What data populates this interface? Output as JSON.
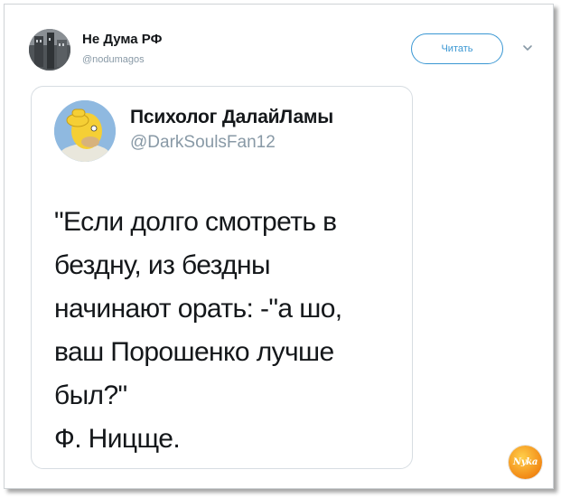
{
  "outer_tweet": {
    "author_name": "Не Дума РФ",
    "author_handle": "@nodumagos",
    "follow_label": "Читать",
    "avatar_icon": "building-avatar-icon",
    "menu_icon": "chevron-down-icon"
  },
  "quoted_tweet": {
    "author_name": "Психолог ДалайЛамы",
    "author_handle": "@DarkSoulsFan12",
    "avatar_icon": "cartoon-character-avatar-icon",
    "text": "\"Если долго смотреть в\nбездну, из бездны\nначинают орать: -\"а шо,\nваш Порошенко лучше\nбыл?\"\nФ. Ницще."
  },
  "watermark": {
    "label": "Nyka",
    "icon": "watermark-logo-icon"
  },
  "colors": {
    "accent": "#3a97d3",
    "text": "#14171a",
    "muted": "#8899a6",
    "border": "#d7dde2"
  }
}
